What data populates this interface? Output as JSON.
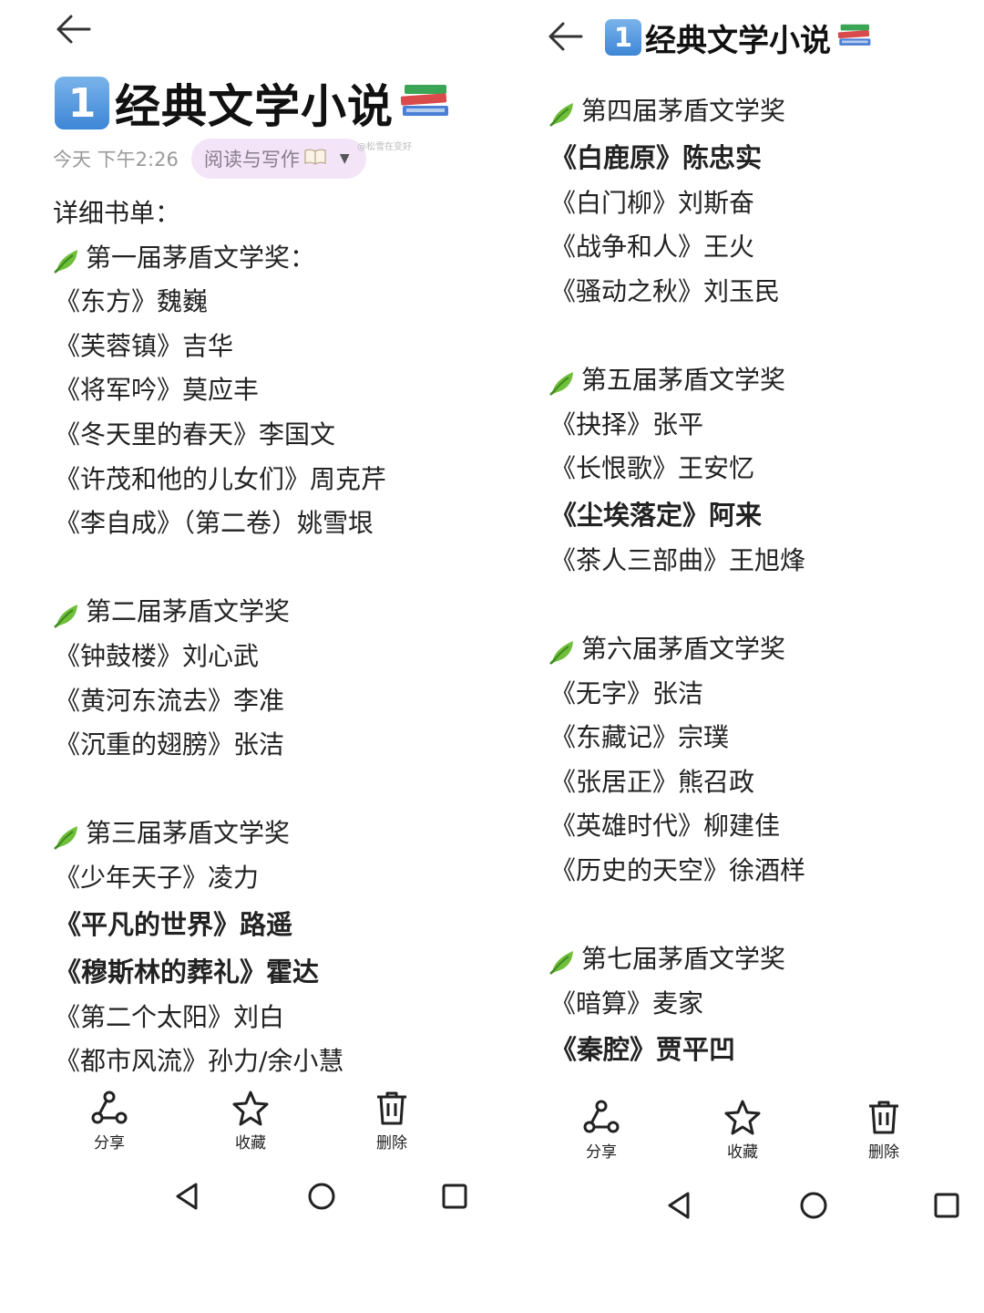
{
  "app": {
    "title_number": "1",
    "title": "经典文学小说",
    "time": "今天 下午2:26",
    "folder": "阅读与写作",
    "watermark": "@松雪在变好"
  },
  "left": {
    "heading": "详细书单：",
    "lines": [
      {
        "type": "award",
        "text": "第一届茅盾文学奖："
      },
      {
        "type": "book",
        "text": "《东方》魏巍"
      },
      {
        "type": "book",
        "text": "《芙蓉镇》吉华"
      },
      {
        "type": "book",
        "text": "《将军吟》莫应丰"
      },
      {
        "type": "book",
        "text": "《冬天里的春天》李国文"
      },
      {
        "type": "book",
        "text": "《许茂和他的儿女们》周克芹"
      },
      {
        "type": "book",
        "text": "《李自成》（第二卷）姚雪垠"
      },
      {
        "type": "gap",
        "text": ""
      },
      {
        "type": "award",
        "text": "第二届茅盾文学奖"
      },
      {
        "type": "book",
        "text": "《钟鼓楼》刘心武"
      },
      {
        "type": "book",
        "text": "《黄河东流去》李准"
      },
      {
        "type": "book",
        "text": "《沉重的翅膀》张洁"
      },
      {
        "type": "gap",
        "text": ""
      },
      {
        "type": "award",
        "text": "第三届茅盾文学奖"
      },
      {
        "type": "book",
        "text": "《少年天子》凌力"
      },
      {
        "type": "bold",
        "text": "《平凡的世界》路遥"
      },
      {
        "type": "bold",
        "text": "《穆斯林的葬礼》霍达"
      },
      {
        "type": "book",
        "text": "《第二个太阳》刘白"
      },
      {
        "type": "book",
        "text": "《都市风流》孙力/余小慧"
      }
    ]
  },
  "right": {
    "lines": [
      {
        "type": "award",
        "text": "第四届茅盾文学奖"
      },
      {
        "type": "bold",
        "text": "《白鹿原》陈忠实"
      },
      {
        "type": "book",
        "text": "《白门柳》刘斯奋"
      },
      {
        "type": "book",
        "text": "《战争和人》王火"
      },
      {
        "type": "book",
        "text": "《骚动之秋》刘玉民"
      },
      {
        "type": "gap",
        "text": ""
      },
      {
        "type": "award",
        "text": "第五届茅盾文学奖"
      },
      {
        "type": "book",
        "text": "《抉择》张平"
      },
      {
        "type": "book",
        "text": "《长恨歌》王安忆"
      },
      {
        "type": "bold",
        "text": "《尘埃落定》阿来"
      },
      {
        "type": "book",
        "text": "《茶人三部曲》王旭烽"
      },
      {
        "type": "gap",
        "text": ""
      },
      {
        "type": "award",
        "text": "第六届茅盾文学奖"
      },
      {
        "type": "book",
        "text": "《无字》张洁"
      },
      {
        "type": "book",
        "text": "《东藏记》宗璞"
      },
      {
        "type": "book",
        "text": "《张居正》熊召政"
      },
      {
        "type": "book",
        "text": "《英雄时代》柳建佳"
      },
      {
        "type": "book",
        "text": "《历史的天空》徐酒样"
      },
      {
        "type": "gap",
        "text": ""
      },
      {
        "type": "award",
        "text": "第七届茅盾文学奖"
      },
      {
        "type": "book",
        "text": "《暗算》麦家"
      },
      {
        "type": "bold",
        "text": "《秦腔》贾平凹"
      }
    ]
  },
  "toolbar": {
    "share": "分享",
    "favorite": "收藏",
    "delete": "删除"
  },
  "icons": {
    "accent": "#4b8de0",
    "leaf": "#6fbf3a",
    "chip_bg": "#f3e4f8"
  }
}
